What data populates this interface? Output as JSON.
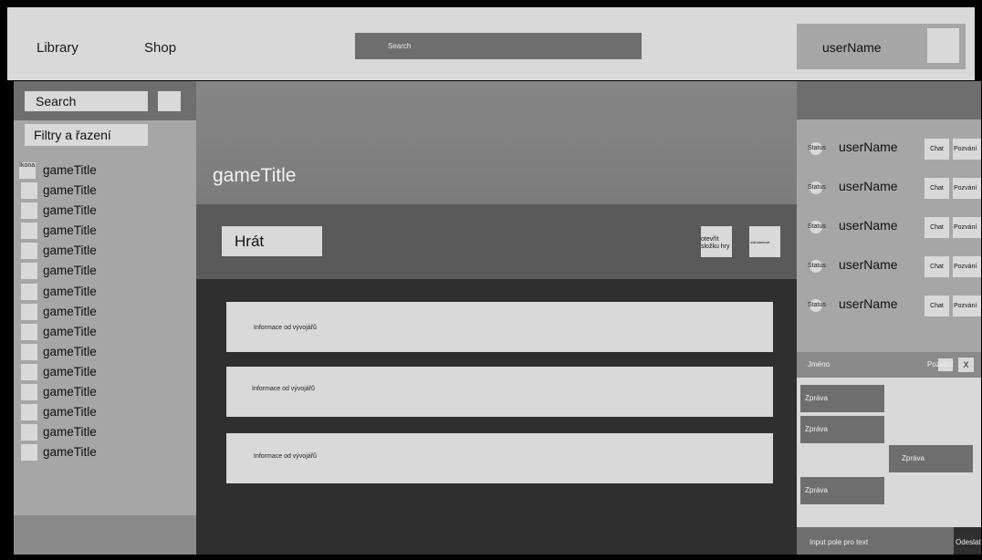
{
  "topbar": {
    "library_label": "Library",
    "shop_label": "Shop",
    "search_placeholder": "Search",
    "user_name": "userName"
  },
  "sidebar": {
    "search_label": "Search",
    "filter_label": "Filtry a řazení",
    "first_icon_label": "Ikona",
    "games": [
      "gameTitle",
      "gameTitle",
      "gameTitle",
      "gameTitle",
      "gameTitle",
      "gameTitle",
      "gameTitle",
      "gameTitle",
      "gameTitle",
      "gameTitle",
      "gameTitle",
      "gameTitle",
      "gameTitle",
      "gameTitle",
      "gameTitle"
    ]
  },
  "main": {
    "game_title": "gameTitle",
    "play_label": "Hrát",
    "open_folder_label": "otevřít složku hry",
    "uninstall_label": "odinstalovat",
    "news": [
      "Informace od vývojářů",
      "Informace od vývojářů",
      "Informace od vývojářů"
    ]
  },
  "friends": {
    "items": [
      {
        "status": "Status",
        "name": "userName",
        "chat": "Chat",
        "invite": "Pozvání"
      },
      {
        "status": "Status",
        "name": "userName",
        "chat": "Chat",
        "invite": "Pozvání"
      },
      {
        "status": "Status",
        "name": "userName",
        "chat": "Chat",
        "invite": "Pozvání"
      },
      {
        "status": "Status",
        "name": "userName",
        "chat": "Chat",
        "invite": "Pozvání"
      },
      {
        "status": "Status",
        "name": "userName",
        "chat": "Chat",
        "invite": "Pozvání"
      }
    ]
  },
  "chat": {
    "name_label": "Jméno",
    "invite_label": "Pozvání",
    "close_label": "X",
    "messages": [
      "Zpráva",
      "Zpráva",
      "Zpráva",
      "Zpráva"
    ],
    "input_placeholder": "Input pole pro text",
    "send_label": "Odeslat"
  }
}
